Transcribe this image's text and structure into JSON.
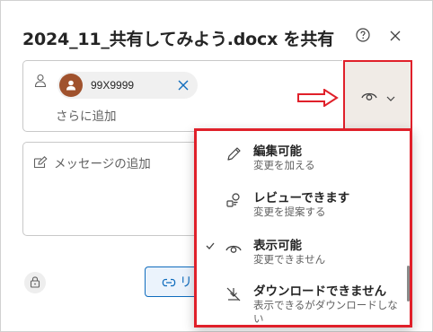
{
  "dialog": {
    "title": "2024_11_共有してみよう.docx を共有",
    "help_icon": "help-circle-icon",
    "close_icon": "close-icon"
  },
  "recipients": {
    "chips": [
      {
        "name": "99X9999",
        "avatar_color": "#a0522d"
      }
    ],
    "add_more_placeholder": "さらに追加"
  },
  "permission_button": {
    "icon": "eye-icon",
    "chevron": "chevron-down-icon"
  },
  "message": {
    "placeholder": "メッセージの追加"
  },
  "footer": {
    "link_label": "リ"
  },
  "permission_menu": {
    "items": [
      {
        "icon": "pencil-icon",
        "title": "編集可能",
        "description": "変更を加える",
        "selected": false
      },
      {
        "icon": "review-icon",
        "title": "レビューできます",
        "description": "変更を提案する",
        "selected": false
      },
      {
        "icon": "eye-icon",
        "title": "表示可能",
        "description": "変更できません",
        "selected": true
      },
      {
        "icon": "no-download-icon",
        "title": "ダウンロードできません",
        "description": "表示できるがダウンロードしない",
        "selected": false
      }
    ]
  },
  "colors": {
    "highlight": "#e0202a",
    "accent": "#0f6cbd",
    "avatar": "#a0522d"
  }
}
